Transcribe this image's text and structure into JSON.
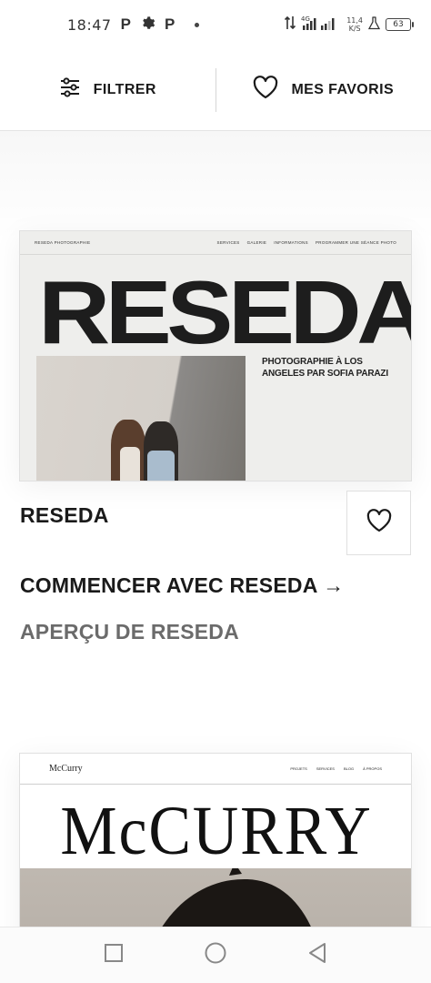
{
  "status_bar": {
    "time": "18:47",
    "net_type": "4G",
    "speed_value": "11,4",
    "speed_unit": "K/S",
    "battery": "63"
  },
  "filter_bar": {
    "filter_label": "FILTRER",
    "favorites_label": "MES FAVORIS"
  },
  "templates": [
    {
      "name": "RESEDA",
      "start_label": "COMMENCER AVEC RESEDA →",
      "preview_label": "APERÇU DE RESEDA",
      "thumbnail": {
        "brand": "RESEDA PHOTOGRAPHIE",
        "nav_links": [
          "SERVICES",
          "GALERIE",
          "INFORMATIONS",
          "PROGRAMMER UNE SÉANCE PHOTO"
        ],
        "headline": "RESEDA",
        "caption": "PHOTOGRAPHIE À LOS ANGELES PAR SOFIA PARAZI"
      }
    },
    {
      "thumbnail": {
        "brand": "McCurry",
        "nav_links": [
          "PROJETS",
          "SERVICES",
          "BLOG",
          "À PROPOS"
        ],
        "headline": "McCURRY"
      }
    }
  ]
}
